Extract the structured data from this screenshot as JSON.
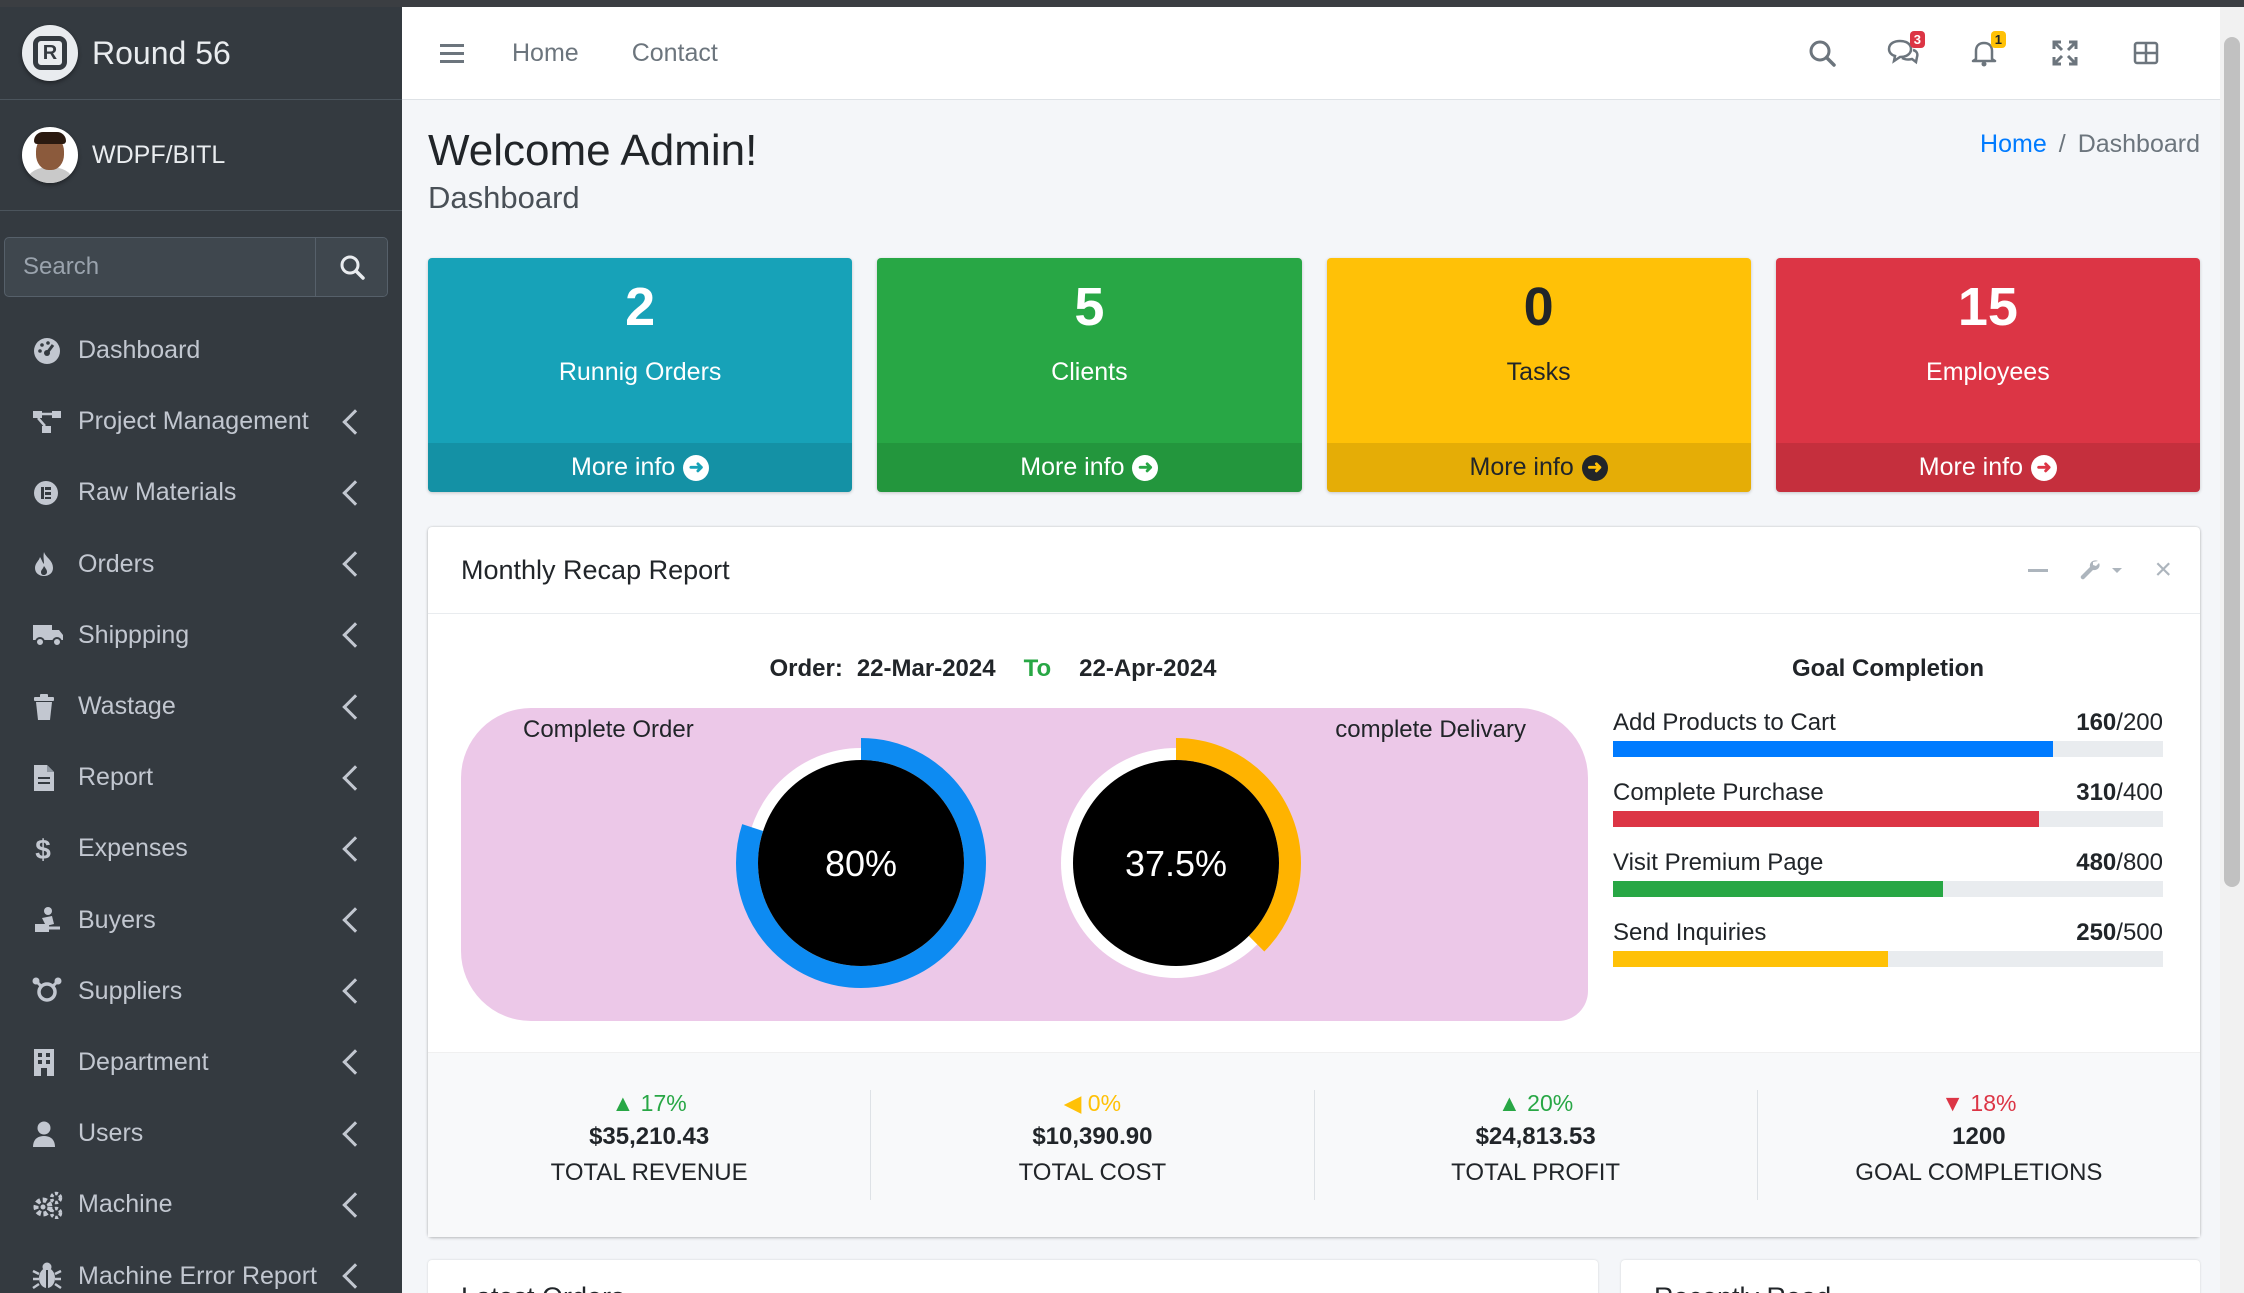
{
  "brand": {
    "name": "Round 56"
  },
  "user": {
    "name": "WDPF/BITL"
  },
  "search": {
    "placeholder": "Search"
  },
  "sidebar": {
    "items": [
      {
        "label": "Dashboard",
        "icon": "dashboard-icon",
        "has_children": false
      },
      {
        "label": "Project Management",
        "icon": "project-diagram-icon",
        "has_children": true
      },
      {
        "label": "Raw Materials",
        "icon": "material-icon",
        "has_children": true
      },
      {
        "label": "Orders",
        "icon": "fire-icon",
        "has_children": true
      },
      {
        "label": "Shippping",
        "icon": "truck-icon",
        "has_children": true
      },
      {
        "label": "Wastage",
        "icon": "trash-icon",
        "has_children": true
      },
      {
        "label": "Report",
        "icon": "file-icon",
        "has_children": true
      },
      {
        "label": "Expenses",
        "icon": "dollar-icon",
        "has_children": true
      },
      {
        "label": "Buyers",
        "icon": "buyer-icon",
        "has_children": true
      },
      {
        "label": "Suppliers",
        "icon": "supplier-icon",
        "has_children": true
      },
      {
        "label": "Department",
        "icon": "building-icon",
        "has_children": true
      },
      {
        "label": "Users",
        "icon": "user-icon",
        "has_children": true
      },
      {
        "label": "Machine",
        "icon": "cogs-icon",
        "has_children": true
      },
      {
        "label": "Machine Error Report",
        "icon": "bug-icon",
        "has_children": true
      }
    ]
  },
  "navbar": {
    "links": [
      "Home",
      "Contact"
    ],
    "messages_count": "3",
    "notifications_count": "1"
  },
  "header": {
    "title": "Welcome Admin!",
    "subtitle": "Dashboard",
    "breadcrumb": {
      "home": "Home",
      "current": "Dashboard"
    }
  },
  "stat_boxes": [
    {
      "value": "2",
      "label": "Runnig Orders",
      "more": "More info",
      "color": "#17a2b8"
    },
    {
      "value": "5",
      "label": "Clients",
      "more": "More info",
      "color": "#28a745"
    },
    {
      "value": "0",
      "label": "Tasks",
      "more": "More info",
      "color": "#ffc107"
    },
    {
      "value": "15",
      "label": "Employees",
      "more": "More info",
      "color": "#dc3545"
    }
  ],
  "report": {
    "title": "Monthly Recap Report",
    "order_label": "Order:",
    "from_date": "22-Mar-2024",
    "to_label": "To",
    "to_date": "22-Apr-2024",
    "complete_order_label": "Complete Order",
    "complete_delivery_label": "complete Delivary",
    "complete_order_pct": "80%",
    "complete_order_value": 80,
    "complete_delivery_pct": "37.5%",
    "complete_delivery_value": 37.5,
    "goal_title": "Goal Completion",
    "goals": [
      {
        "label": "Add Products to Cart",
        "done": "160",
        "total": "/200",
        "pct": 80,
        "color": "#007bff"
      },
      {
        "label": "Complete Purchase",
        "done": "310",
        "total": "/400",
        "pct": 77.5,
        "color": "#dc3545"
      },
      {
        "label": "Visit Premium Page",
        "done": "480",
        "total": "/800",
        "pct": 60,
        "color": "#28a745"
      },
      {
        "label": "Send Inquiries",
        "done": "250",
        "total": "/500",
        "pct": 50,
        "color": "#ffc107"
      }
    ],
    "footer": [
      {
        "pct": "17%",
        "trend": "up",
        "value": "$35,210.43",
        "label": "TOTAL REVENUE"
      },
      {
        "pct": "0%",
        "trend": "flat",
        "value": "$10,390.90",
        "label": "TOTAL COST"
      },
      {
        "pct": "20%",
        "trend": "up",
        "value": "$24,813.53",
        "label": "TOTAL PROFIT"
      },
      {
        "pct": "18%",
        "trend": "down",
        "value": "1200",
        "label": "GOAL COMPLETIONS"
      }
    ]
  },
  "lower_cards": [
    "Latest Orders",
    "Recently Read"
  ]
}
